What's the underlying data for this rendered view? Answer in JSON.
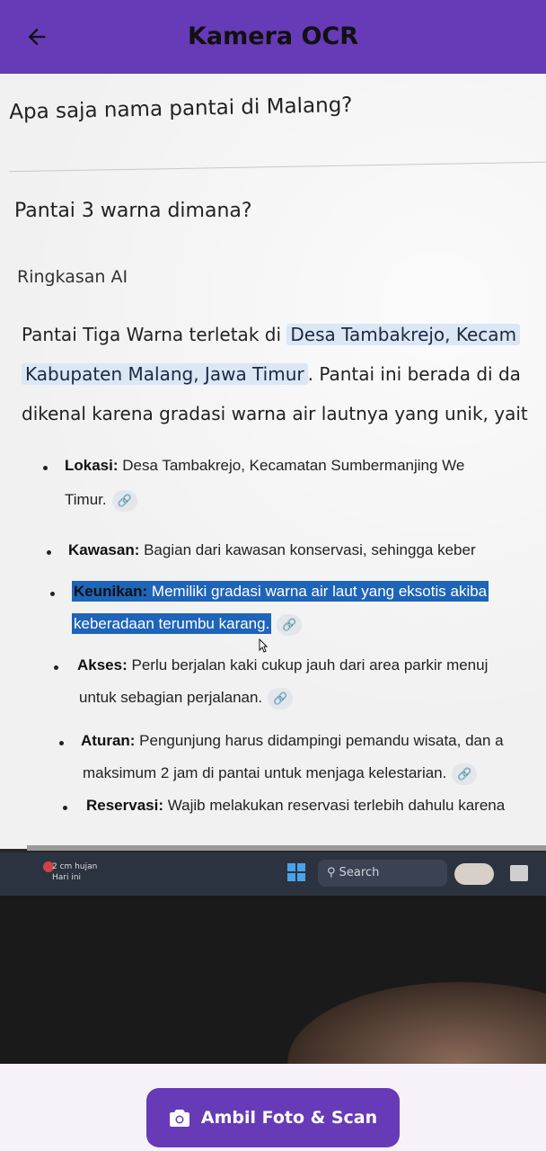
{
  "appbar": {
    "title": "Kamera OCR"
  },
  "photo": {
    "question1": "Apa saja nama pantai di Malang?",
    "question2": "Pantai 3 warna dimana?",
    "ai_label": "Ringkasan AI",
    "paragraph": {
      "line1_prefix": "Pantai Tiga Warna terletak di ",
      "line1_highlight": "Desa Tambakrejo, Kecam",
      "line2_highlight": "Kabupaten Malang, Jawa Timur",
      "line2_suffix": ". Pantai ini berada di da",
      "line3": "dikenal karena gradasi warna air lautnya yang unik, yait"
    },
    "list": [
      {
        "label": "Lokasi:",
        "text": " Desa Tambakrejo, Kecamatan Sumbermanjing We",
        "cont": "Timur."
      },
      {
        "label": "Kawasan:",
        "text": " Bagian dari kawasan konservasi, sehingga keber"
      },
      {
        "label": "Keunikan:",
        "text": " Memiliki gradasi warna air laut yang eksotis akiba",
        "cont": "keberadaan terumbu karang."
      },
      {
        "label": "Akses:",
        "text": " Perlu berjalan kaki cukup jauh dari area parkir menuj",
        "cont": "untuk sebagian perjalanan."
      },
      {
        "label": "Aturan:",
        "text": " Pengunjung harus didampingi pemandu wisata, dan a",
        "cont": "maksimum 2 jam di pantai untuk menjaga kelestarian."
      },
      {
        "label": "Reservasi:",
        "text": " Wajib melakukan reservasi terlebih dahulu karena"
      }
    ],
    "taskbar": {
      "weather_line1": "2 cm hujan",
      "weather_line2": "Hari ini",
      "search": "Search"
    }
  },
  "bottom": {
    "scan_button_label": "Ambil Foto & Scan"
  },
  "colors": {
    "primary": "#673ab7",
    "selection": "#1e64b8",
    "highlight": "#dbe7f5"
  }
}
